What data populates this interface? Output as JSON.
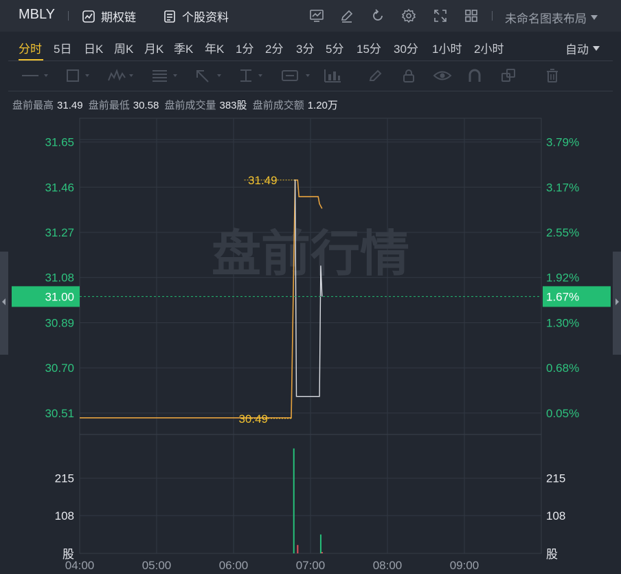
{
  "header": {
    "symbol": "MBLY",
    "options_chain": "期权链",
    "stock_profile": "个股资料",
    "layout_name": "未命名图表布局"
  },
  "periods": [
    "分时",
    "5日",
    "日K",
    "周K",
    "月K",
    "季K",
    "年K",
    "1分",
    "2分",
    "3分",
    "5分",
    "15分",
    "30分",
    "1小时",
    "2小时"
  ],
  "active_period": "分时",
  "auto_label": "自动",
  "premarket": {
    "high_label": "盘前最高",
    "high": "31.49",
    "low_label": "盘前最低",
    "low": "30.58",
    "vol_label": "盘前成交量",
    "vol": "383股",
    "amt_label": "盘前成交额",
    "amt": "1.20万"
  },
  "watermark": "盘前行情",
  "price_axis": {
    "left_ticks": [
      "31.65",
      "31.46",
      "31.27",
      "31.08",
      "30.89",
      "30.70",
      "30.51"
    ],
    "right_ticks": [
      "3.79%",
      "3.17%",
      "2.55%",
      "1.92%",
      "1.30%",
      "0.68%",
      "0.05%"
    ],
    "current_price": "31.00",
    "current_pct": "1.67%"
  },
  "volume_axis": {
    "ticks": [
      "215",
      "108"
    ],
    "unit": "股"
  },
  "time_axis": [
    "04:00",
    "05:00",
    "06:00",
    "07:00",
    "08:00",
    "09:00"
  ],
  "chart_data": {
    "type": "line",
    "price_ylim": [
      30.42,
      31.75
    ],
    "volume_ylim": [
      0,
      340
    ],
    "high_annotation": "31.49",
    "low_annotation": "30.49",
    "avg_line": [
      [
        "04:00",
        30.49
      ],
      [
        "06:45",
        30.49
      ],
      [
        "06:48",
        31.49
      ],
      [
        "06:50",
        31.49
      ],
      [
        "06:51",
        31.42
      ],
      [
        "07:06",
        31.42
      ],
      [
        "07:07",
        31.39
      ],
      [
        "07:09",
        31.37
      ]
    ],
    "price_line": [
      [
        "06:47",
        31.49
      ],
      [
        "06:48",
        31.49
      ],
      [
        "06:49",
        30.58
      ],
      [
        "07:07",
        30.58
      ],
      [
        "07:08",
        31.13
      ],
      [
        "07:09",
        31.0
      ]
    ],
    "volume_bars": [
      {
        "time": "06:47",
        "value": 300,
        "dir": "up"
      },
      {
        "time": "06:50",
        "value": 24,
        "dir": "down"
      },
      {
        "time": "07:08",
        "value": 54,
        "dir": "up"
      },
      {
        "time": "07:09",
        "value": 4,
        "dir": "down"
      }
    ],
    "colors": {
      "avg": "#e7a33f",
      "price": "#dcdfe5",
      "up": "#26c17a",
      "down": "#e0525b",
      "axis_green": "#2ec27e",
      "annotation": "#f2c230",
      "price_tag": "#23bd73"
    }
  }
}
